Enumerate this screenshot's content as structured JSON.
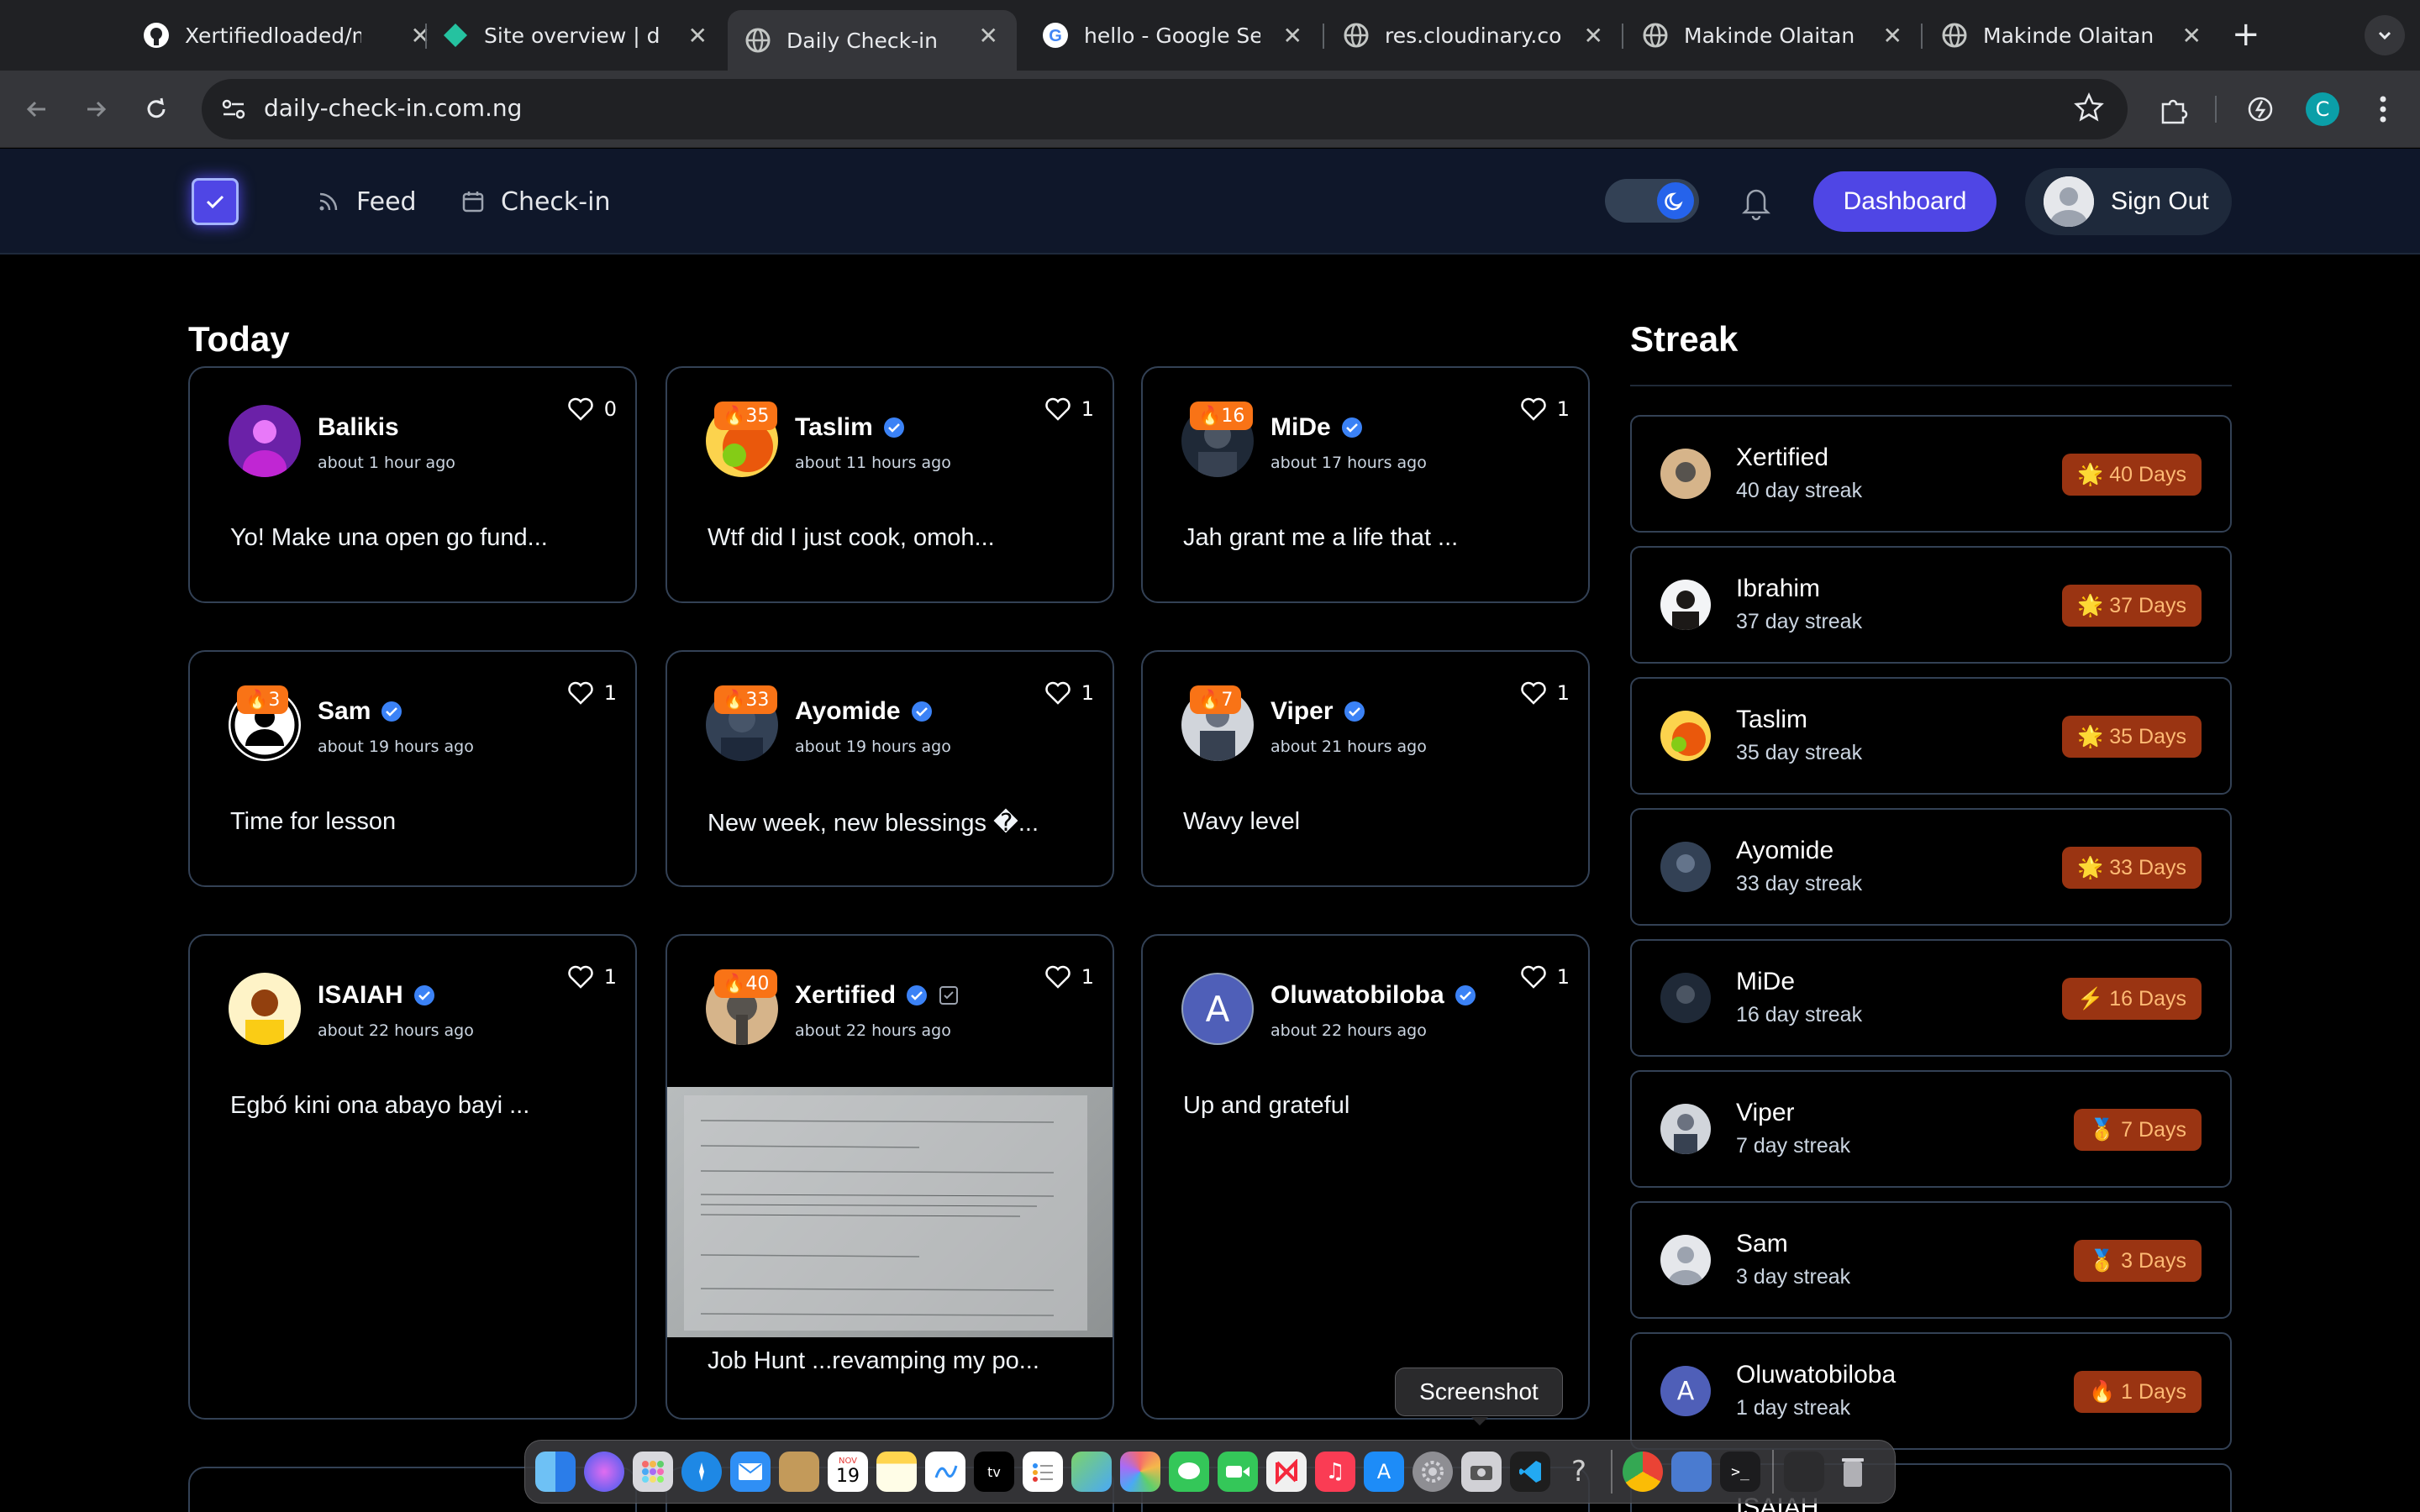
{
  "browser": {
    "tabs": [
      {
        "title": "Xertifiedloaded/makinde",
        "icon": "github-icon"
      },
      {
        "title": "Site overview | daily",
        "icon": "netlify-icon"
      },
      {
        "title": "Daily Check-in",
        "icon": "globe-icon"
      },
      {
        "title": "hello - Google Search",
        "icon": "google-icon"
      },
      {
        "title": "res.cloudinary.com",
        "icon": "globe-icon"
      },
      {
        "title": "Makinde Olaitan",
        "icon": "globe-icon"
      },
      {
        "title": "Makinde Olaitan",
        "icon": "globe-icon"
      }
    ],
    "url": "daily-check-in.com.ng",
    "profile_initial": "C"
  },
  "header": {
    "nav": {
      "feed": "Feed",
      "checkin": "Check-in"
    },
    "dashboard": "Dashboard",
    "signout": "Sign Out"
  },
  "today": {
    "title": "Today",
    "posts": [
      {
        "name": "Balikis",
        "time": "about 1 hour ago",
        "likes": "0",
        "text": "Yo! Make una open go fund...",
        "verified": false,
        "streak": ""
      },
      {
        "name": "Taslim",
        "time": "about 11 hours ago",
        "likes": "1",
        "text": "Wtf did I just cook, omoh...",
        "verified": true,
        "streak": "🔥35"
      },
      {
        "name": "MiDe",
        "time": "about 17 hours ago",
        "likes": "1",
        "text": "Jah grant me a life that ...",
        "verified": true,
        "streak": "🔥16"
      },
      {
        "name": "Sam",
        "time": "about 19 hours ago",
        "likes": "1",
        "text": "Time for lesson",
        "verified": true,
        "streak": "🔥3"
      },
      {
        "name": "Ayomide",
        "time": "about 19 hours ago",
        "likes": "1",
        "text": "New week, new blessings �...",
        "verified": true,
        "streak": "🔥33"
      },
      {
        "name": "Viper",
        "time": "about 21 hours ago",
        "likes": "1",
        "text": "Wavy level",
        "verified": true,
        "streak": "🔥7"
      },
      {
        "name": "ISAIAH",
        "time": "about 22 hours ago",
        "likes": "1",
        "text": "Egbó kini ona abayo bayi ...",
        "verified": true,
        "streak": ""
      },
      {
        "name": "Xertified",
        "time": "about 22 hours ago",
        "likes": "1",
        "text": "Job Hunt ...revamping my po...",
        "verified": true,
        "streak": "🔥40"
      },
      {
        "name": "Oluwatobiloba",
        "time": "about 22 hours ago",
        "likes": "1",
        "text": "Up and grateful",
        "verified": true,
        "streak": "",
        "initial": "A"
      }
    ]
  },
  "streak": {
    "title": "Streak",
    "rows": [
      {
        "name": "Xertified",
        "sub": "40 day streak",
        "badge": "🌟 40 Days"
      },
      {
        "name": "Ibrahim",
        "sub": "37 day streak",
        "badge": "🌟 37 Days"
      },
      {
        "name": "Taslim",
        "sub": "35 day streak",
        "badge": "🌟 35 Days"
      },
      {
        "name": "Ayomide",
        "sub": "33 day streak",
        "badge": "🌟 33 Days"
      },
      {
        "name": "MiDe",
        "sub": "16 day streak",
        "badge": "⚡ 16 Days"
      },
      {
        "name": "Viper",
        "sub": "7 day streak",
        "badge": "🥇 7 Days"
      },
      {
        "name": "Sam",
        "sub": "3 day streak",
        "badge": "🥇 3 Days"
      },
      {
        "name": "Oluwatobiloba",
        "sub": "1 day streak",
        "badge": "🔥 1 Days",
        "initial": "A"
      }
    ],
    "partial_name": "ISAIAH"
  },
  "dock": {
    "tooltip": "Screenshot",
    "calendar_month": "NOV",
    "calendar_day": "19"
  }
}
